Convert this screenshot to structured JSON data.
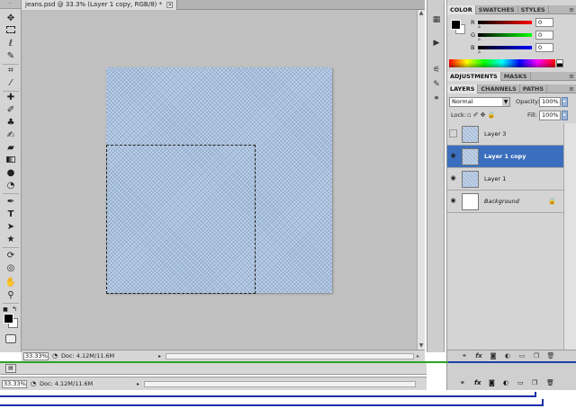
{
  "document": {
    "tab_title": "jeans.psd @ 33.3% (Layer 1 copy, RGB/8) *",
    "close_glyph": "×",
    "zoom": "33.33%",
    "doc_info": "Doc: 4.12M/11.6M",
    "doc_info_arrow": "▸"
  },
  "colors": {
    "canvas": "#a9c0dc",
    "selected_layer": "#3b6fbe",
    "foreground": "#000000",
    "background": "#ffffff"
  },
  "color_panel": {
    "tabs": [
      "COLOR",
      "SWATCHES",
      "STYLES"
    ],
    "sliders": [
      {
        "label": "R",
        "value": "0",
        "color": "#cc0000"
      },
      {
        "label": "G",
        "value": "0",
        "color": "#00aa00"
      },
      {
        "label": "B",
        "value": "0",
        "color": "#0000cc"
      }
    ]
  },
  "adjustments_panel": {
    "tabs": [
      "ADJUSTMENTS",
      "MASKS"
    ]
  },
  "layers_panel": {
    "tabs": [
      "LAYERS",
      "CHANNELS",
      "PATHS"
    ],
    "blend_mode": "Normal",
    "opacity_label": "Opacity:",
    "opacity_value": "100%",
    "lock_label": "Lock:",
    "fill_label": "Fill:",
    "fill_value": "100%",
    "layers": [
      {
        "name": "Layer 3",
        "visible": false,
        "selected": false
      },
      {
        "name": "Layer 1 copy",
        "visible": true,
        "selected": true
      },
      {
        "name": "Layer 1",
        "visible": true,
        "selected": false
      },
      {
        "name": "Background",
        "visible": true,
        "selected": false
      }
    ]
  },
  "tools": [
    "move-tool",
    "marquee-tool",
    "lasso-tool",
    "quick-selection-tool",
    "crop-tool",
    "eyedropper-tool",
    "healing-brush-tool",
    "brush-tool",
    "clone-stamp-tool",
    "history-brush-tool",
    "eraser-tool",
    "gradient-tool",
    "blur-tool",
    "dodge-tool",
    "pen-tool",
    "type-tool",
    "path-selection-tool",
    "shape-tool",
    "3d-rotate-tool",
    "3d-orbit-tool",
    "hand-tool",
    "zoom-tool"
  ],
  "lower_statusbar": {
    "zoom": "33.33%",
    "doc_info": "Doc: 4.12M/11.6M"
  }
}
